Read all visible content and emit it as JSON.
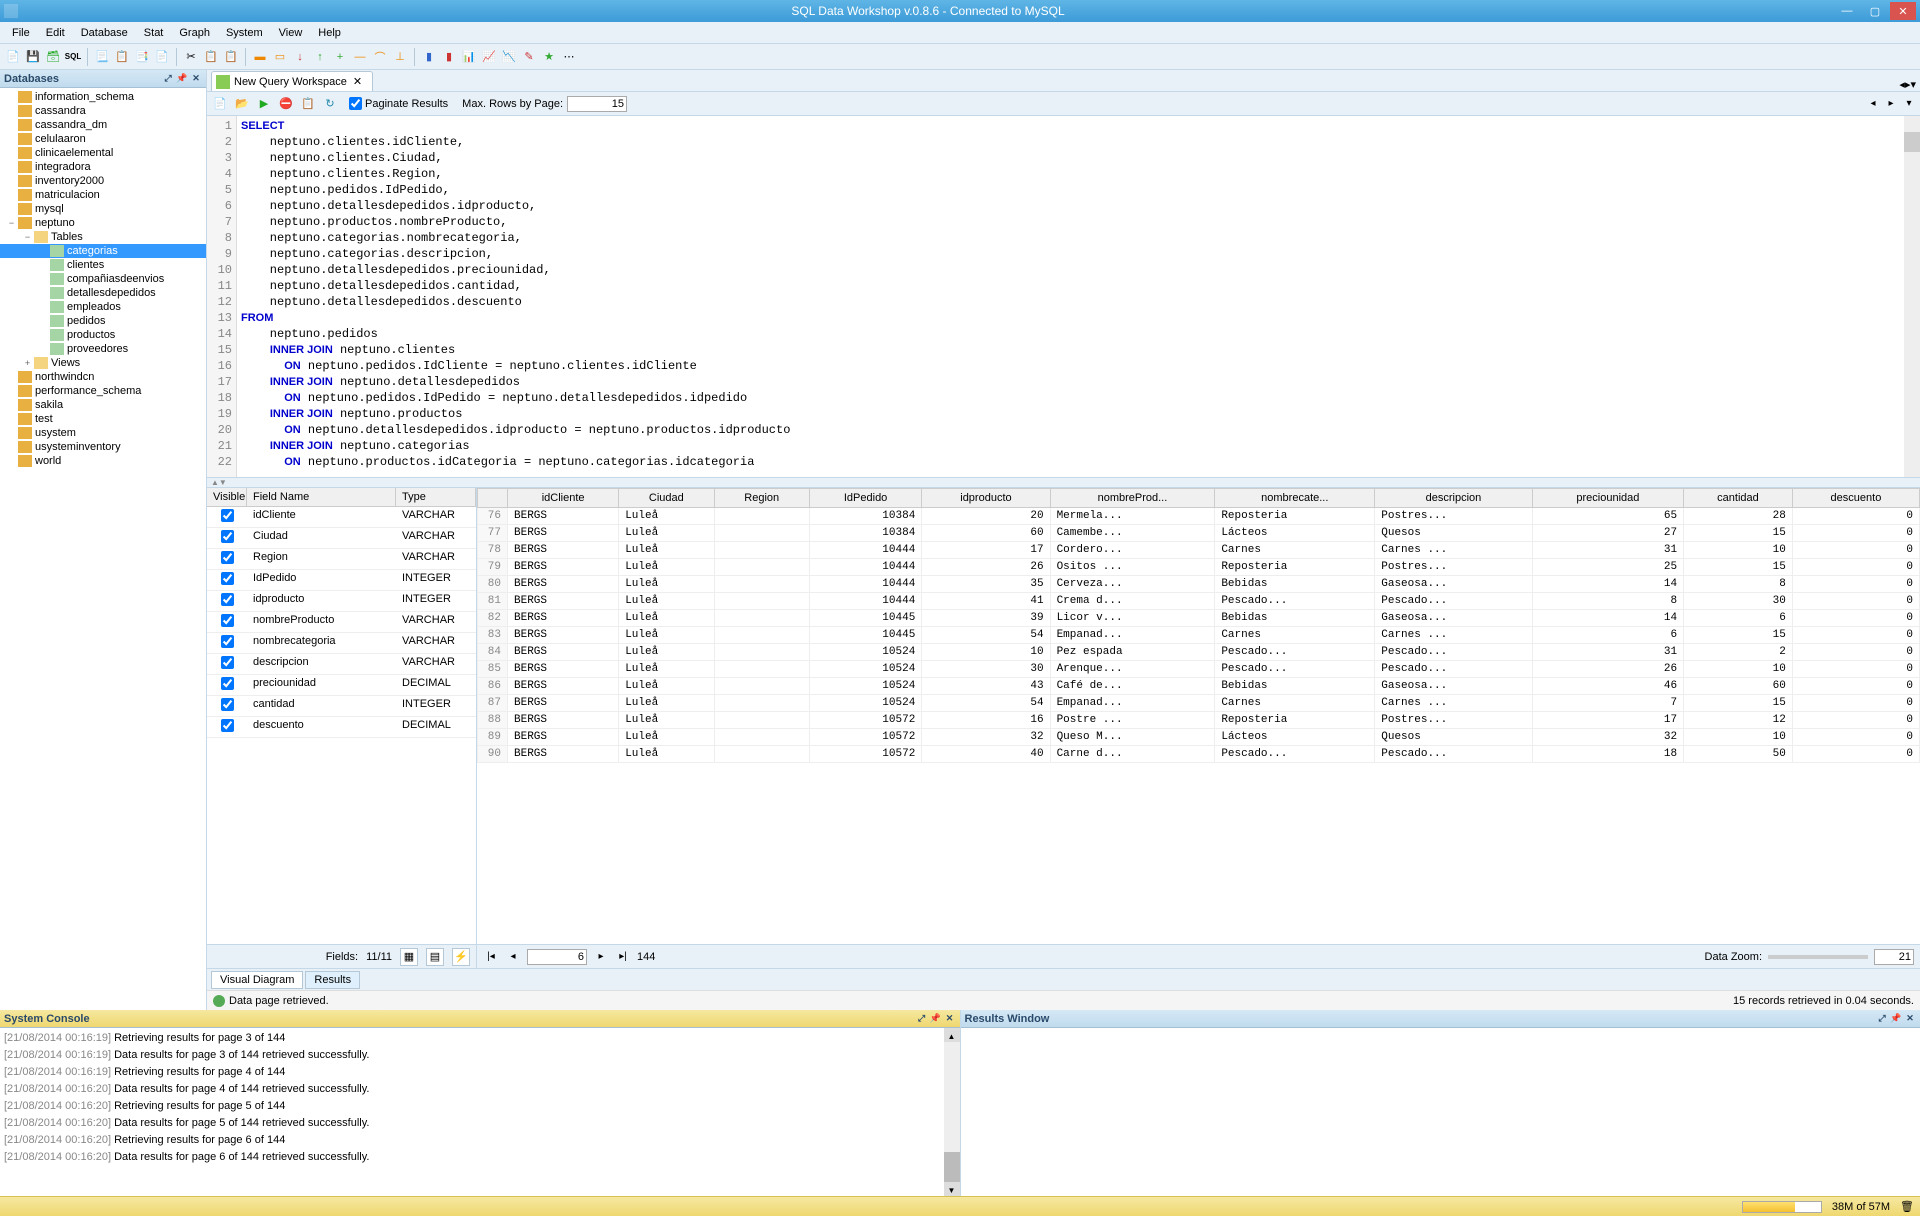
{
  "app": {
    "title": "SQL Data Workshop v.0.8.6 - Connected to MySQL"
  },
  "menubar": [
    "File",
    "Edit",
    "Database",
    "Stat",
    "Graph",
    "System",
    "View",
    "Help"
  ],
  "sidebar": {
    "title": "Databases",
    "items": [
      {
        "label": "information_schema",
        "indent": 0,
        "type": "db",
        "exp": ""
      },
      {
        "label": "cassandra",
        "indent": 0,
        "type": "db",
        "exp": ""
      },
      {
        "label": "cassandra_dm",
        "indent": 0,
        "type": "db",
        "exp": ""
      },
      {
        "label": "celulaaron",
        "indent": 0,
        "type": "db",
        "exp": ""
      },
      {
        "label": "clinicaelemental",
        "indent": 0,
        "type": "db",
        "exp": ""
      },
      {
        "label": "integradora",
        "indent": 0,
        "type": "db",
        "exp": ""
      },
      {
        "label": "inventory2000",
        "indent": 0,
        "type": "db",
        "exp": ""
      },
      {
        "label": "matriculacion",
        "indent": 0,
        "type": "db",
        "exp": ""
      },
      {
        "label": "mysql",
        "indent": 0,
        "type": "db",
        "exp": ""
      },
      {
        "label": "neptuno",
        "indent": 0,
        "type": "db",
        "exp": "−"
      },
      {
        "label": "Tables",
        "indent": 1,
        "type": "folder",
        "exp": "−"
      },
      {
        "label": "categorias",
        "indent": 2,
        "type": "table",
        "selected": true,
        "exp": ""
      },
      {
        "label": "clientes",
        "indent": 2,
        "type": "table",
        "exp": ""
      },
      {
        "label": "compañiasdeenvios",
        "indent": 2,
        "type": "table",
        "exp": ""
      },
      {
        "label": "detallesdepedidos",
        "indent": 2,
        "type": "table",
        "exp": ""
      },
      {
        "label": "empleados",
        "indent": 2,
        "type": "table",
        "exp": ""
      },
      {
        "label": "pedidos",
        "indent": 2,
        "type": "table",
        "exp": ""
      },
      {
        "label": "productos",
        "indent": 2,
        "type": "table",
        "exp": ""
      },
      {
        "label": "proveedores",
        "indent": 2,
        "type": "table",
        "exp": ""
      },
      {
        "label": "Views",
        "indent": 1,
        "type": "folder",
        "exp": "+"
      },
      {
        "label": "northwindcn",
        "indent": 0,
        "type": "db",
        "exp": ""
      },
      {
        "label": "performance_schema",
        "indent": 0,
        "type": "db",
        "exp": ""
      },
      {
        "label": "sakila",
        "indent": 0,
        "type": "db",
        "exp": ""
      },
      {
        "label": "test",
        "indent": 0,
        "type": "db",
        "exp": ""
      },
      {
        "label": "usystem",
        "indent": 0,
        "type": "db",
        "exp": ""
      },
      {
        "label": "usysteminventory",
        "indent": 0,
        "type": "db",
        "exp": ""
      },
      {
        "label": "world",
        "indent": 0,
        "type": "db",
        "exp": ""
      }
    ]
  },
  "tab": {
    "label": "New Query Workspace"
  },
  "query_toolbar": {
    "paginate_label": "Paginate Results",
    "paginate_checked": true,
    "max_rows_label": "Max. Rows by Page:",
    "max_rows_value": "15"
  },
  "sql": {
    "lines": [
      {
        "n": 1,
        "html": "<span class='kw'>SELECT</span>"
      },
      {
        "n": 2,
        "html": "    neptuno.clientes.idCliente,"
      },
      {
        "n": 3,
        "html": "    neptuno.clientes.Ciudad,"
      },
      {
        "n": 4,
        "html": "    neptuno.clientes.Region,"
      },
      {
        "n": 5,
        "html": "    neptuno.pedidos.IdPedido,"
      },
      {
        "n": 6,
        "html": "    neptuno.detallesdepedidos.idproducto,"
      },
      {
        "n": 7,
        "html": "    neptuno.productos.nombreProducto,"
      },
      {
        "n": 8,
        "html": "    neptuno.categorias.nombrecategoria,"
      },
      {
        "n": 9,
        "html": "    neptuno.categorias.descripcion,"
      },
      {
        "n": 10,
        "html": "    neptuno.detallesdepedidos.preciounidad,"
      },
      {
        "n": 11,
        "html": "    neptuno.detallesdepedidos.cantidad,"
      },
      {
        "n": 12,
        "html": "    neptuno.detallesdepedidos.descuento"
      },
      {
        "n": 13,
        "html": "<span class='kw'>FROM</span>"
      },
      {
        "n": 14,
        "html": "    neptuno.pedidos"
      },
      {
        "n": 15,
        "html": "    <span class='kw'>INNER JOIN</span> neptuno.clientes"
      },
      {
        "n": 16,
        "html": "      <span class='kw'>ON</span> neptuno.pedidos.IdCliente = neptuno.clientes.idCliente"
      },
      {
        "n": 17,
        "html": "    <span class='kw'>INNER JOIN</span> neptuno.detallesdepedidos"
      },
      {
        "n": 18,
        "html": "      <span class='kw'>ON</span> neptuno.pedidos.IdPedido = neptuno.detallesdepedidos.idpedido"
      },
      {
        "n": 19,
        "html": "    <span class='kw'>INNER JOIN</span> neptuno.productos"
      },
      {
        "n": 20,
        "html": "      <span class='kw'>ON</span> neptuno.detallesdepedidos.idproducto = neptuno.productos.idproducto"
      },
      {
        "n": 21,
        "html": "    <span class='kw'>INNER JOIN</span> neptuno.categorias"
      },
      {
        "n": 22,
        "html": "      <span class='kw'>ON</span> neptuno.productos.idCategoria = neptuno.categorias.idcategoria"
      }
    ]
  },
  "fields": {
    "header": {
      "visible": "Visible",
      "name": "Field Name",
      "type": "Type"
    },
    "rows": [
      {
        "name": "idCliente",
        "type": "VARCHAR"
      },
      {
        "name": "Ciudad",
        "type": "VARCHAR"
      },
      {
        "name": "Region",
        "type": "VARCHAR"
      },
      {
        "name": "IdPedido",
        "type": "INTEGER"
      },
      {
        "name": "idproducto",
        "type": "INTEGER"
      },
      {
        "name": "nombreProducto",
        "type": "VARCHAR"
      },
      {
        "name": "nombrecategoria",
        "type": "VARCHAR"
      },
      {
        "name": "descripcion",
        "type": "VARCHAR"
      },
      {
        "name": "preciounidad",
        "type": "DECIMAL"
      },
      {
        "name": "cantidad",
        "type": "INTEGER"
      },
      {
        "name": "descuento",
        "type": "DECIMAL"
      }
    ],
    "footer_label": "Fields:",
    "footer_count": "11/11"
  },
  "grid": {
    "columns": [
      "",
      "idCliente",
      "Ciudad",
      "Region",
      "IdPedido",
      "idproducto",
      "nombreProd...",
      "nombrecate...",
      "descripcion",
      "preciounidad",
      "cantidad",
      "descuento"
    ],
    "rows": [
      [
        "76",
        "BERGS",
        "Luleå",
        "",
        "10384",
        "20",
        "Mermela...",
        "Reposteria",
        "Postres...",
        "65",
        "28",
        "0"
      ],
      [
        "77",
        "BERGS",
        "Luleå",
        "",
        "10384",
        "60",
        "Camembe...",
        "Lácteos",
        "Quesos",
        "27",
        "15",
        "0"
      ],
      [
        "78",
        "BERGS",
        "Luleå",
        "",
        "10444",
        "17",
        "Cordero...",
        "Carnes",
        "Carnes ...",
        "31",
        "10",
        "0"
      ],
      [
        "79",
        "BERGS",
        "Luleå",
        "",
        "10444",
        "26",
        "Ositos ...",
        "Reposteria",
        "Postres...",
        "25",
        "15",
        "0"
      ],
      [
        "80",
        "BERGS",
        "Luleå",
        "",
        "10444",
        "35",
        "Cerveza...",
        "Bebidas",
        "Gaseosa...",
        "14",
        "8",
        "0"
      ],
      [
        "81",
        "BERGS",
        "Luleå",
        "",
        "10444",
        "41",
        "Crema d...",
        "Pescado...",
        "Pescado...",
        "8",
        "30",
        "0"
      ],
      [
        "82",
        "BERGS",
        "Luleå",
        "",
        "10445",
        "39",
        "Licor v...",
        "Bebidas",
        "Gaseosa...",
        "14",
        "6",
        "0"
      ],
      [
        "83",
        "BERGS",
        "Luleå",
        "",
        "10445",
        "54",
        "Empanad...",
        "Carnes",
        "Carnes ...",
        "6",
        "15",
        "0"
      ],
      [
        "84",
        "BERGS",
        "Luleå",
        "",
        "10524",
        "10",
        "Pez espada",
        "Pescado...",
        "Pescado...",
        "31",
        "2",
        "0"
      ],
      [
        "85",
        "BERGS",
        "Luleå",
        "",
        "10524",
        "30",
        "Arenque...",
        "Pescado...",
        "Pescado...",
        "26",
        "10",
        "0"
      ],
      [
        "86",
        "BERGS",
        "Luleå",
        "",
        "10524",
        "43",
        "Café de...",
        "Bebidas",
        "Gaseosa...",
        "46",
        "60",
        "0"
      ],
      [
        "87",
        "BERGS",
        "Luleå",
        "",
        "10524",
        "54",
        "Empanad...",
        "Carnes",
        "Carnes ...",
        "7",
        "15",
        "0"
      ],
      [
        "88",
        "BERGS",
        "Luleå",
        "",
        "10572",
        "16",
        "Postre ...",
        "Reposteria",
        "Postres...",
        "17",
        "12",
        "0"
      ],
      [
        "89",
        "BERGS",
        "Luleå",
        "",
        "10572",
        "32",
        "Queso M...",
        "Lácteos",
        "Quesos",
        "32",
        "10",
        "0"
      ],
      [
        "90",
        "BERGS",
        "Luleå",
        "",
        "10572",
        "40",
        "Carne d...",
        "Pescado...",
        "Pescado...",
        "18",
        "50",
        "0"
      ]
    ]
  },
  "pager": {
    "current": "6",
    "total": "144",
    "zoom_label": "Data Zoom:",
    "zoom_value": "21"
  },
  "bottom_tabs": {
    "diagram": "Visual Diagram",
    "results": "Results"
  },
  "status_msg": "Data page retrieved.",
  "status_right": "15 records retrieved in 0.04 seconds.",
  "console": {
    "title": "System Console",
    "lines": [
      {
        "ts": "[21/08/2014 00:16:19]",
        "msg": "Retrieving results for page 3 of 144"
      },
      {
        "ts": "[21/08/2014 00:16:19]",
        "msg": "Data results for page 3 of 144 retrieved successfully."
      },
      {
        "ts": "[21/08/2014 00:16:19]",
        "msg": "Retrieving results for page 4 of 144"
      },
      {
        "ts": "[21/08/2014 00:16:20]",
        "msg": "Data results for page 4 of 144 retrieved successfully."
      },
      {
        "ts": "[21/08/2014 00:16:20]",
        "msg": "Retrieving results for page 5 of 144"
      },
      {
        "ts": "[21/08/2014 00:16:20]",
        "msg": "Data results for page 5 of 144 retrieved successfully."
      },
      {
        "ts": "[21/08/2014 00:16:20]",
        "msg": "Retrieving results for page 6 of 144"
      },
      {
        "ts": "[21/08/2014 00:16:20]",
        "msg": "Data results for page 6 of 144 retrieved successfully."
      }
    ]
  },
  "results_window": {
    "title": "Results Window"
  },
  "memory": "38M of 57M"
}
